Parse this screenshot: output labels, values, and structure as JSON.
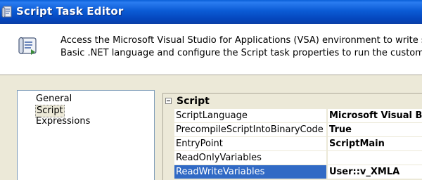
{
  "window": {
    "title": "Script Task Editor",
    "title_icon": "script-task-icon"
  },
  "header": {
    "icon": "script-scroll-icon",
    "description_line1": "Access the Microsoft Visual Studio for Applications (VSA) environment to write s",
    "description_line2": "Basic .NET language and configure the Script task properties to run the custom"
  },
  "nav": {
    "items": [
      {
        "label": "General",
        "selected": false
      },
      {
        "label": "Script",
        "selected": true
      },
      {
        "label": "Expressions",
        "selected": false
      }
    ]
  },
  "grid": {
    "category": "Script",
    "properties": [
      {
        "name": "ScriptLanguage",
        "value": "Microsoft Visual Bas",
        "selected": false
      },
      {
        "name": "PrecompileScriptIntoBinaryCode",
        "value": "True",
        "selected": false
      },
      {
        "name": "EntryPoint",
        "value": "ScriptMain",
        "selected": false
      },
      {
        "name": "ReadOnlyVariables",
        "value": "",
        "selected": false
      },
      {
        "name": "ReadWriteVariables",
        "value": "User::v_XMLA",
        "selected": true
      }
    ]
  },
  "colors": {
    "titlebar": "#0b5bd5",
    "selection": "#316ac5",
    "dialog_bg": "#ece9d8"
  }
}
